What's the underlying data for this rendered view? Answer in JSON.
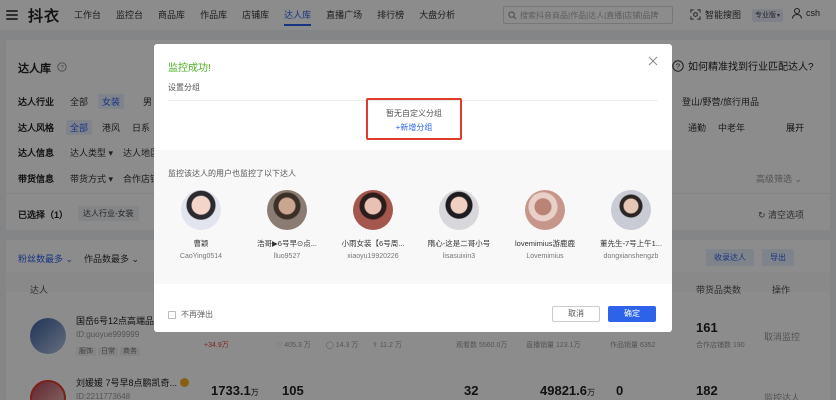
{
  "nav": {
    "logo": "抖衣",
    "items": [
      "工作台",
      "监控台",
      "商品库",
      "作品库",
      "店铺库",
      "达人库",
      "直播广场",
      "排行榜",
      "大盘分析"
    ],
    "active_index": 5,
    "search_placeholder": "搜索抖音商品|作品|达人|直播|店铺|品牌",
    "image_search": "智能搜图",
    "pro_label": "专业版",
    "user": "csh"
  },
  "page": {
    "title": "达人库",
    "help_link": "如何精准找到行业匹配达人?",
    "filters": {
      "industry_label": "达人行业",
      "industry_all": "全部",
      "industry_selected": "女装",
      "industry_more": "男",
      "industry_tail": "登山/野营/旅行用品",
      "style_label": "达人风格",
      "style_all": "全部",
      "style_1": "港风",
      "style_2": "日系",
      "style_tail_1": "通勤",
      "style_tail_2": "中老年",
      "expand": "展开",
      "info_label": "达人信息",
      "info_1": "达人类型",
      "info_2": "达人地区",
      "goods_label": "带货信息",
      "goods_1": "带货方式",
      "goods_2": "合作店铺",
      "advanced": "高级筛选"
    },
    "selected_label": "已选择（1）",
    "selected_chip": "达人行业-女装",
    "clear": "清空选项"
  },
  "list": {
    "sort_1": "粉丝数最多",
    "sort_2": "作品数最多",
    "col_talent": "达人",
    "col_goods_count": "带货品类数",
    "col_action": "操作",
    "add_btn": "收录达人",
    "export_btn": "导出",
    "rows": [
      {
        "name": "国岳6号12点高端品牌",
        "id": "ID:guoyue999999",
        "tags": [
          "服饰",
          "日常",
          "商务"
        ],
        "delta": "+34.9万",
        "likes": "405.3 万",
        "comments": "14.3 万",
        "shares": "11.2 万",
        "views": "观看数 5560.0万",
        "sales": "直播销量 123.1万",
        "works_sales": "作品销量 6352",
        "goods_count": "161",
        "shops": "合作店铺数 190",
        "action": "取消监控"
      },
      {
        "name": "刘媛媛 7号早8点鹏凯奇...",
        "id": "ID:2211773648",
        "fans": "1733.1",
        "fans_unit": "万",
        "works": "105",
        "live": "32",
        "gmv": "49821.6",
        "gmv_unit": "万",
        "zero": "0",
        "goods_count": "182",
        "action": "监控达人"
      }
    ]
  },
  "modal": {
    "title": "监控成功!",
    "subtitle": "设置分组",
    "empty_group": "暂无自定义分组",
    "add_group": "+新增分组",
    "also_title": "监控该达人的用户也监控了以下达人",
    "kols": [
      {
        "name": "曹颖",
        "id": "CaoYing0514",
        "color": "#d9dde6"
      },
      {
        "name": "浩哥▶6号早⊙点...",
        "id": "lluo9527",
        "color": "#6b5a4e"
      },
      {
        "name": "小雨女装【6号周...",
        "id": "xiaoyu19920226",
        "color": "#8d4f46"
      },
      {
        "name": "隋心-这是二哥小号",
        "id": "lisasuixin3",
        "color": "#4c4a52"
      },
      {
        "name": "lovemimius游鹿鹿",
        "id": "Lovemimius",
        "color": "#c9a196"
      },
      {
        "name": "董先生-7号上午1...",
        "id": "dongxianshengzb",
        "color": "#b5b8c2"
      }
    ],
    "no_popup": "不再弹出",
    "cancel": "取消",
    "confirm": "确定"
  },
  "colors": {
    "accent": "#2c63e9",
    "success": "#4caf22",
    "highlight": "#e03a2c"
  }
}
